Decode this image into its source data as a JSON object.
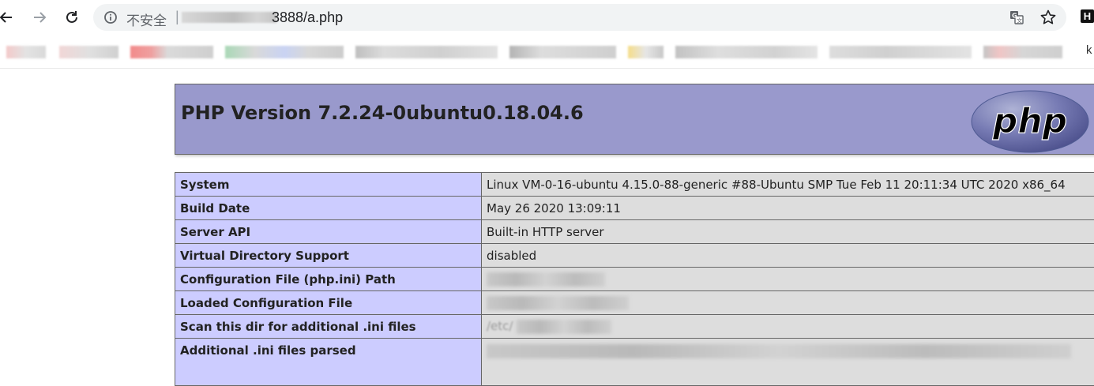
{
  "browser": {
    "security_label": "不安全",
    "url_separator": "|",
    "url_visible": "3888/a.php",
    "extension_label": "H",
    "bookmark_end_char": "k"
  },
  "header": {
    "title": "PHP Version 7.2.24-0ubuntu0.18.04.6",
    "logo_text": "php"
  },
  "info_rows": [
    {
      "key": "System",
      "value": "Linux VM-0-16-ubuntu 4.15.0-88-generic #88-Ubuntu SMP Tue Feb 11 20:11:34 UTC 2020 x86_64"
    },
    {
      "key": "Build Date",
      "value": "May 26 2020 13:09:11"
    },
    {
      "key": "Server API",
      "value": "Built-in HTTP server"
    },
    {
      "key": "Virtual Directory Support",
      "value": "disabled"
    },
    {
      "key": "Configuration File (php.ini) Path",
      "value": ""
    },
    {
      "key": "Loaded Configuration File",
      "value": ""
    },
    {
      "key": "Scan this dir for additional .ini files",
      "value": "/etc/"
    },
    {
      "key": "Additional .ini files parsed",
      "value": ""
    }
  ],
  "colors": {
    "header_bg": "#9999cc",
    "key_bg": "#ccccff",
    "value_bg": "#dddddd"
  }
}
